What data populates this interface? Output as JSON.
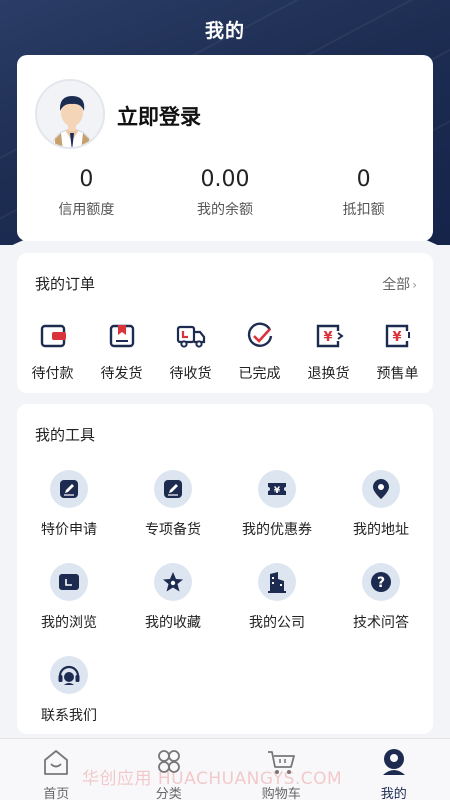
{
  "header": {
    "title": "我的"
  },
  "profile": {
    "login_label": "立即登录",
    "stats": [
      {
        "value": "0",
        "label": "信用额度"
      },
      {
        "value": "0.00",
        "label": "我的余额"
      },
      {
        "value": "0",
        "label": "抵扣额"
      }
    ]
  },
  "orders": {
    "title": "我的订单",
    "all_label": "全部",
    "items": [
      {
        "label": "待付款",
        "icon": "wallet-icon"
      },
      {
        "label": "待发货",
        "icon": "box-icon"
      },
      {
        "label": "待收货",
        "icon": "truck-icon"
      },
      {
        "label": "已完成",
        "icon": "check-circle-icon"
      },
      {
        "label": "退换货",
        "icon": "yuan-return-icon"
      },
      {
        "label": "预售单",
        "icon": "yuan-presale-icon"
      }
    ]
  },
  "tools": {
    "title": "我的工具",
    "items": [
      {
        "label": "特价申请",
        "icon": "edit-icon"
      },
      {
        "label": "专项备货",
        "icon": "edit-icon"
      },
      {
        "label": "我的优惠券",
        "icon": "coupon-icon"
      },
      {
        "label": "我的地址",
        "icon": "location-icon"
      },
      {
        "label": "我的浏览",
        "icon": "history-icon"
      },
      {
        "label": "我的收藏",
        "icon": "star-icon"
      },
      {
        "label": "我的公司",
        "icon": "building-icon"
      },
      {
        "label": "技术问答",
        "icon": "question-icon"
      },
      {
        "label": "联系我们",
        "icon": "headset-icon"
      }
    ]
  },
  "tabbar": {
    "items": [
      {
        "label": "首页",
        "icon": "home-icon"
      },
      {
        "label": "分类",
        "icon": "category-icon"
      },
      {
        "label": "购物车",
        "icon": "cart-icon"
      },
      {
        "label": "我的",
        "icon": "profile-icon",
        "active": true
      }
    ]
  },
  "watermark": "华创应用 HUACHUANGYS.COM",
  "colors": {
    "primary": "#1c2b4f",
    "accent_red": "#d9343e",
    "icon_bg": "#dde5f1"
  }
}
